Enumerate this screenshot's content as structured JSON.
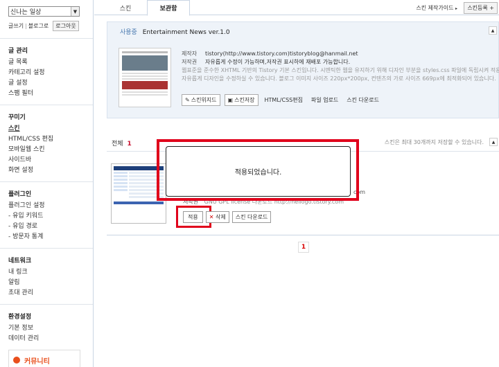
{
  "sidebar": {
    "blog_select": "신나는 일상",
    "top_links": {
      "write": "글쓰기",
      "home": "블로그로",
      "logout": "로그아웃"
    },
    "groups": [
      {
        "title": "글 관리",
        "items": [
          "글 목록",
          "카테고리 설정",
          "글 설정",
          "스팸 필터"
        ]
      },
      {
        "title": "꾸미기",
        "items": [
          "스킨",
          "HTML/CSS 편집",
          "모바일웹 스킨",
          "사이드바",
          "화면 설정"
        ]
      },
      {
        "title": "플러그인",
        "items": [
          "플러그인 설정",
          "- 유입 키워드",
          "- 유입 경로",
          "- 방문자 통계"
        ]
      },
      {
        "title": "네트워크",
        "items": [
          "내 링크",
          "알림",
          "초대 관리"
        ]
      },
      {
        "title": "환경설정",
        "items": [
          "기본 정보",
          "데이터 관리"
        ]
      }
    ],
    "community": "커뮤니티"
  },
  "tabs": {
    "skin": "스킨",
    "storage": "보관함"
  },
  "header_links": {
    "guide": "스킨 제작가이드",
    "register": "스킨등록 +"
  },
  "current_skin": {
    "in_use": "사용중",
    "name": "Entertainment News ver.1.0",
    "author_label": "제작자",
    "author": "tistory(http://www.tistory.com)tistoryblog@hanmail.net",
    "copyright_label": "저작권",
    "copyright": "자유롭게 수정이 가능하며,저작권 표시하에 재배포 가능합니다.",
    "desc1": "웹표준을 준수한 XHTML 기반의 Tistory 기본 스킨입니다. 시멘틱한 웹을 유지하기 위해 디자인 부분을 styles.css 파일에 독립시켜 적용하였으며",
    "desc2": "자유롭게 디자인을 수정하실 수 있습니다. 블로그 이미지 사이즈 220px*200px, 컨텐츠의 가로 사이즈 669px에 최적화되어 있습니다.",
    "btn_skin_widget": "스킨위지드",
    "btn_skin_save": "스킨저장",
    "btn_html_css": "HTML/CSS편집",
    "btn_file_upload": "파일 업로드",
    "btn_skin_download": "스킨 다운로드"
  },
  "list": {
    "total_label": "전체",
    "total_count": "1",
    "note": "스킨은 최대 30개까지 저장할 수 있습니다.",
    "item": {
      "license_label": "저작권",
      "license": "GNU GPL license 다운로드 http://hellogo.tistory.com",
      "trunc_text": "com",
      "btn_apply": "적용",
      "btn_delete": "삭제",
      "btn_download": "스킨 다운로드"
    }
  },
  "pager": {
    "current": "1"
  },
  "dialog": {
    "message": "적용되었습니다."
  }
}
